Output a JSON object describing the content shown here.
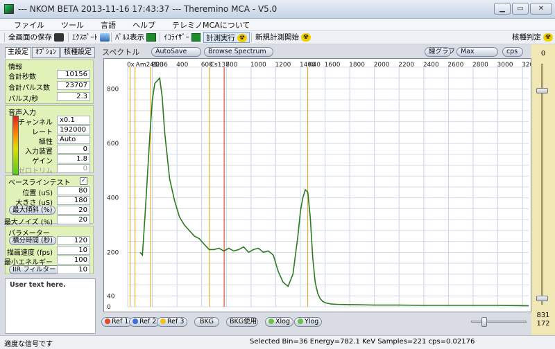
{
  "window": {
    "title": "--- NKOM BETA 2013-11-16  17:43:37 --- Theremino MCA - V5.0",
    "minimize_label": "▁",
    "maximize_label": "▭",
    "close_label": "✕"
  },
  "menu": [
    "ファイル",
    "ツール",
    "言語",
    "ヘルプ",
    "テレミノMCAについて"
  ],
  "toolbar": {
    "save_screen": "全画面の保存",
    "export": "ｴｸｽﾎﾟｰﾄ",
    "pulse_display": "ﾊﾟﾙｽ表示",
    "equalizer": "ｲｺﾗｲｻﾞｰ",
    "run_measure": "計測実行",
    "new_measure": "新規計測開始",
    "nuclide_judge": "核種判定",
    "rad_glyph": "☢"
  },
  "tabs": [
    "主設定",
    "ｵﾌﾟｼｮﾝ",
    "核種設定"
  ],
  "info": {
    "title": "情報",
    "total_seconds_label": "合計秒数",
    "total_seconds": "10156",
    "total_pulses_label": "合計パルス数",
    "total_pulses": "23707",
    "pulse_rate_label": "パルス/秒",
    "pulse_rate": "2.3"
  },
  "audio": {
    "title": "音声入力",
    "channel_label": "チャンネル",
    "channel": "x0.1",
    "rate_label": "レート",
    "rate": "192000",
    "polarity_label": "極性",
    "polarity": "Auto",
    "input_device_label": "入力装置",
    "input_device": "0",
    "gain_label": "ゲイン",
    "gain": "1.8",
    "zero_trim_label": "ゼロトリム",
    "zero_trim": "0"
  },
  "baseline": {
    "title": "ベースラインテスト",
    "checked": "✓",
    "position_label": "位置 (uS)",
    "position": "80",
    "size_label": "大きさ (uS)",
    "size": "180",
    "max_slope_label": "最大傾斜 (%)",
    "max_slope": "20",
    "max_noise_label": "最大ノイズ (%)",
    "max_noise": "20"
  },
  "params": {
    "title": "パラメーター",
    "integration_label": "積分時間 (秒)",
    "integration": "120",
    "draw_speed_label": "描画速度 (fps)",
    "draw_speed": "10",
    "min_energy_label": "最小エネルギー",
    "min_energy": "100",
    "iir_label": "IIR フィルター (%)",
    "iir": "10"
  },
  "user_text": "User text here.",
  "spectrum": {
    "label": "スペクトル",
    "autosave": "AutoSave",
    "browse": "Browse Spectrum",
    "line_graph": "線グラフ",
    "max": "Max",
    "cps": "cps"
  },
  "right_scale": {
    "top": "0",
    "bottom1": "831",
    "bottom2": "172"
  },
  "bottom_buttons": {
    "ref1": "Ref 1",
    "ref2": "Ref 2",
    "ref3": "Ref 3",
    "bkg": "BKG",
    "bkg_use": "BKG使用",
    "xlog": "Xlog",
    "ylog": "Ylog"
  },
  "status": {
    "signal": "適度な信号です",
    "readout": "Selected Bin=36  Energy=782.1 KeV  Samples=221  cps=0.02176"
  },
  "chart_data": {
    "type": "line",
    "title": "",
    "xlabel": "",
    "ylabel": "",
    "xlim": [
      0,
      3250
    ],
    "ylim": [
      0,
      880
    ],
    "x_ticks": [
      0,
      200,
      400,
      600,
      800,
      1000,
      1200,
      1400,
      1600,
      1800,
      2000,
      2200,
      2400,
      2600,
      2800,
      3000,
      3200
    ],
    "y_ticks": [
      0,
      40,
      200,
      400,
      600,
      800
    ],
    "grid": true,
    "line_color": "#2c7a1f",
    "markers": [
      {
        "label": "x",
        "x": 20,
        "color": "#e0a000"
      },
      {
        "label": "Am241",
        "x": 60,
        "color": "#e0a000"
      },
      {
        "label": "U236",
        "x": 186,
        "color": "#e0a000"
      },
      {
        "label": "Cs137",
        "x": 662,
        "color": "#e0a000"
      },
      {
        "label": "",
        "x": 782,
        "color": "#d03000"
      },
      {
        "label": "K40",
        "x": 1460,
        "color": "#e0a000"
      }
    ],
    "series": [
      {
        "x": [
          100,
          120,
          140,
          160,
          180,
          200,
          220,
          240,
          260,
          280,
          300,
          340,
          380,
          420,
          460,
          500,
          540,
          580,
          620,
          660,
          700,
          740,
          780,
          820,
          860,
          900,
          940,
          980,
          1020,
          1060,
          1100,
          1140,
          1180,
          1220,
          1260,
          1300,
          1340,
          1380,
          1400,
          1420,
          1440,
          1460,
          1480,
          1500,
          1520,
          1540,
          1560,
          1580,
          1600,
          1650,
          1700,
          1800,
          1900,
          2000,
          2200,
          2400,
          2600,
          2800,
          3000,
          3200,
          3250
        ],
        "y": [
          200,
          190,
          330,
          480,
          630,
          760,
          820,
          830,
          840,
          770,
          640,
          470,
          390,
          330,
          300,
          280,
          260,
          250,
          230,
          210,
          210,
          215,
          205,
          215,
          205,
          210,
          220,
          200,
          210,
          215,
          200,
          205,
          190,
          130,
          90,
          75,
          120,
          260,
          350,
          400,
          430,
          420,
          330,
          180,
          90,
          50,
          30,
          20,
          15,
          10,
          9,
          8,
          7,
          6,
          6,
          5,
          5,
          5,
          5,
          4,
          4
        ]
      }
    ]
  }
}
